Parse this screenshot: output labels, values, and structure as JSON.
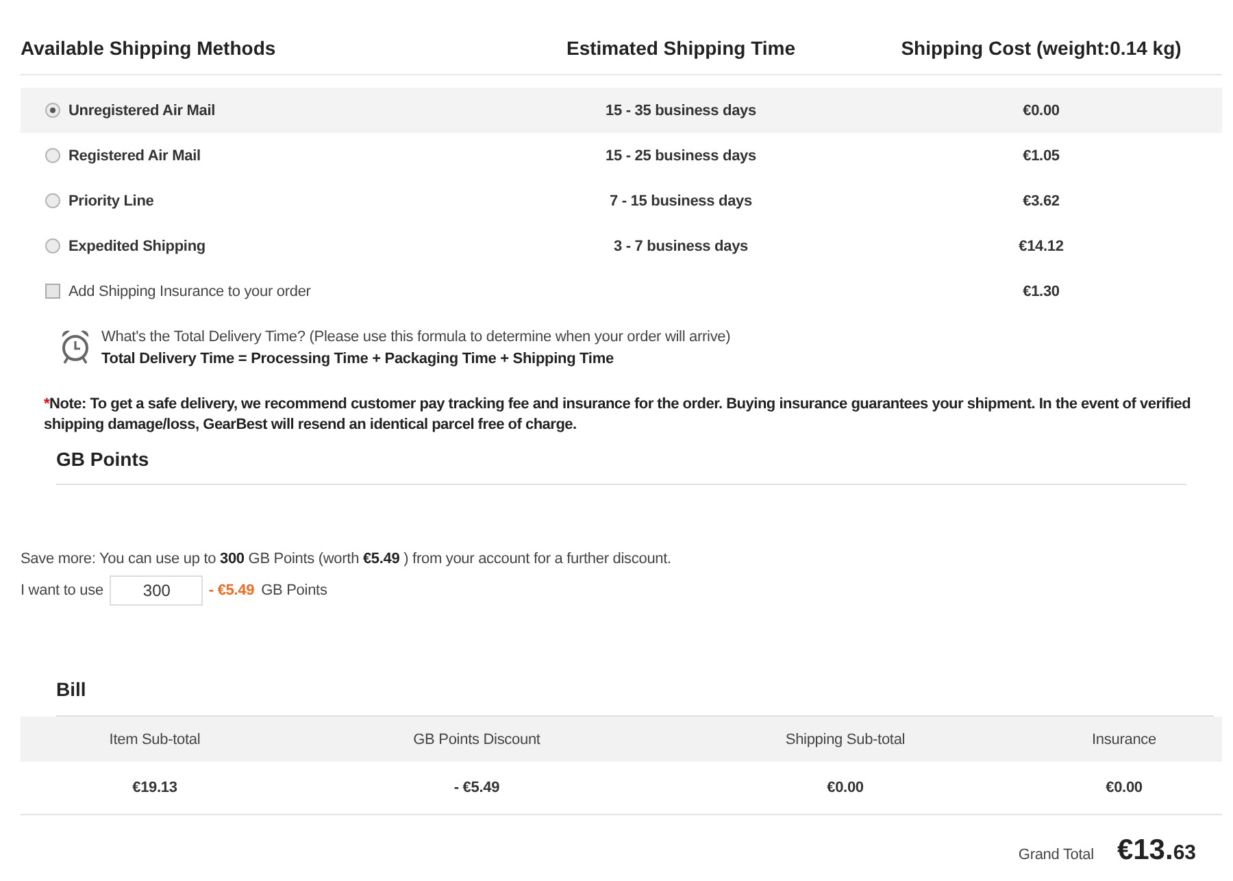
{
  "shipping": {
    "columns": [
      "Available Shipping Methods",
      "Estimated Shipping Time",
      "Shipping Cost (weight:0.14 kg)"
    ],
    "methods": [
      {
        "name": "Unregistered Air Mail",
        "time": "15 - 35 business days",
        "cost": "€0.00",
        "selected": true
      },
      {
        "name": "Registered Air Mail",
        "time": "15 - 25 business days",
        "cost": "€1.05",
        "selected": false
      },
      {
        "name": "Priority Line",
        "time": "7 - 15 business days",
        "cost": "€3.62",
        "selected": false
      },
      {
        "name": "Expedited Shipping",
        "time": "3 - 7 business days",
        "cost": "€14.12",
        "selected": false
      }
    ],
    "insurance": {
      "label": "Add Shipping Insurance to your order",
      "cost": "€1.30",
      "checked": false
    }
  },
  "delivery_time": {
    "question": "What's the Total Delivery Time? (Please use this formula to determine when your order will arrive)",
    "formula": "Total Delivery Time = Processing Time + Packaging Time + Shipping Time"
  },
  "note": {
    "marker": "*",
    "text": "Note: To get a safe delivery, we recommend customer pay tracking fee and insurance for the order. Buying insurance guarantees your shipment. In the event of verified shipping damage/loss, GearBest will resend an identical parcel free of charge."
  },
  "gb_points": {
    "title": "GB Points",
    "info": "Save more: You can use up to **300** GB Points (worth **€5.49** ) from your account for a further discount.",
    "use_label": "I want to use",
    "input_value": "300",
    "discount": "- €5.49",
    "unit": "GB Points"
  },
  "bill": {
    "title": "Bill",
    "columns": [
      "Item Sub-total",
      "GB Points Discount",
      "Shipping Sub-total",
      "Insurance"
    ],
    "values": [
      "€19.13",
      "- €5.49",
      "€0.00",
      "€0.00"
    ],
    "grand_total": {
      "label": "Grand Total",
      "whole": "€13.",
      "cents": "63"
    }
  }
}
